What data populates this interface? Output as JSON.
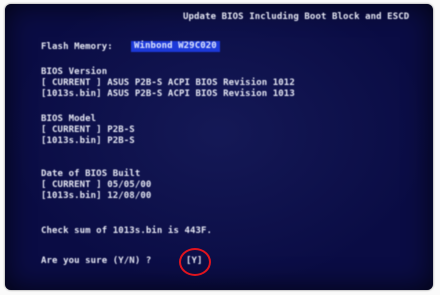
{
  "screen": {
    "title": "Update BIOS Including Boot Block and ESCD",
    "flash_memory": {
      "label": "Flash Memory:",
      "value": "Winbond W29C020"
    },
    "bios_version": {
      "heading": "BIOS Version",
      "current": "[ CURRENT ] ASUS P2B-S ACPI BIOS Revision 1012",
      "file": "[1013s.bin] ASUS P2B-S ACPI BIOS Revision 1013"
    },
    "bios_model": {
      "heading": "BIOS Model",
      "current": "[ CURRENT ] P2B-S",
      "file": "[1013s.bin] P2B-S"
    },
    "bios_date": {
      "heading": "Date of BIOS Built",
      "current": "[ CURRENT ] 05/05/00",
      "file": "[1013s.bin] 12/08/00"
    },
    "checksum": "Check sum of 1013s.bin is 443F.",
    "confirm": {
      "prompt": "Are you sure (Y/N) ?",
      "answer": "[Y]"
    }
  },
  "colors": {
    "screen_background": "#0a0c44",
    "text": "#e6e8f4",
    "field_highlight": "#1c39d8",
    "annotation_circle": "#e0141e"
  }
}
